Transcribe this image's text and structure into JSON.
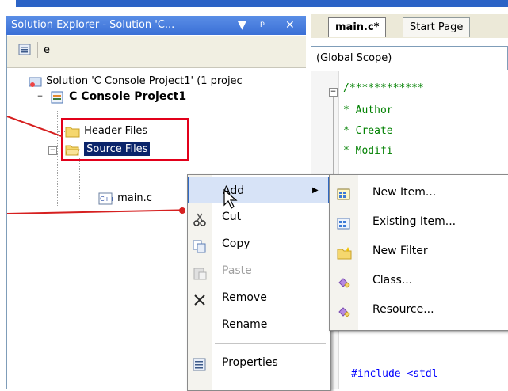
{
  "solution_explorer": {
    "title": "Solution Explorer - Solution 'C...",
    "pin_glyph": "▾",
    "autohide_glyph": "ᵖ",
    "close_glyph": "✕",
    "toolbar_partial_text": "e",
    "tree": {
      "solution": "Solution 'C Console Project1' (1 projec",
      "project": "C Console Project1",
      "header_files": "Header Files",
      "source_files": "Source Files",
      "main_c": "main.c"
    }
  },
  "editor": {
    "tabs": [
      {
        "label": "main.c*",
        "active": true
      },
      {
        "label": "Start Page",
        "active": false
      }
    ],
    "scope": "(Global Scope)",
    "code_lines": [
      "/************",
      "*       Author",
      "*       Create",
      "*       Modifi",
      "#include <stdl"
    ]
  },
  "context_menu": {
    "items": [
      {
        "label": "Add",
        "icon": "none",
        "has_submenu": true,
        "selected": true
      },
      {
        "label": "Cut",
        "icon": "scissors-icon"
      },
      {
        "label": "Copy",
        "icon": "copy-icon"
      },
      {
        "label": "Paste",
        "icon": "paste-icon",
        "disabled": true
      },
      {
        "label": "Remove",
        "icon": "x-icon"
      },
      {
        "label": "Rename",
        "icon": "none"
      },
      {
        "label": "Properties",
        "icon": "properties-icon"
      }
    ],
    "submenu_arrow": "▶"
  },
  "submenu": {
    "items": [
      {
        "label": "New Item...",
        "icon": "new-item-icon"
      },
      {
        "label": "Existing Item...",
        "icon": "existing-item-icon"
      },
      {
        "label": "New Filter",
        "icon": "folder-icon"
      },
      {
        "label": "Class...",
        "icon": "class-icon"
      },
      {
        "label": "Resource...",
        "icon": "resource-icon"
      }
    ]
  },
  "colors": {
    "title_bar": "#3b70d6",
    "highlight_red": "#e2001a",
    "code_green": "#008000",
    "selection_blue": "#0a246a"
  }
}
